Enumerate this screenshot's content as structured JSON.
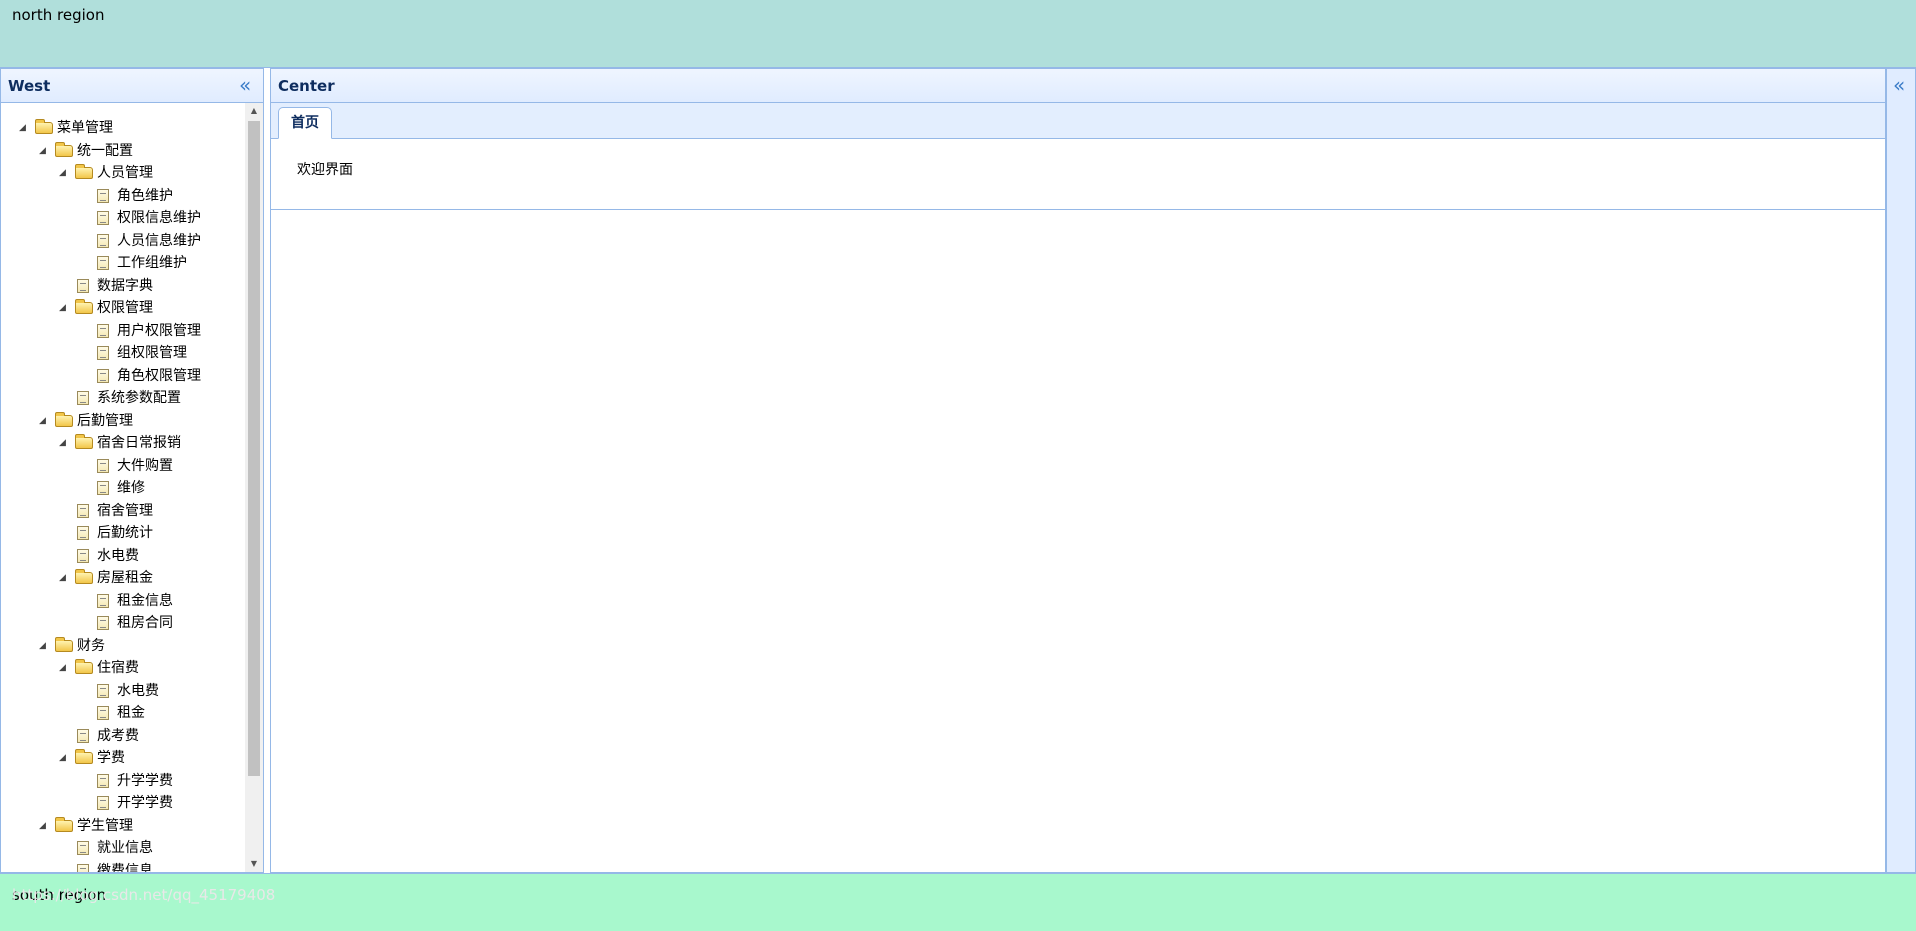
{
  "north": {
    "text": "north region"
  },
  "south": {
    "text": "south region"
  },
  "watermark": "https://blog.csdn.net/qq_45179408",
  "west": {
    "title": "West",
    "collapse_icon": "«",
    "tree": [
      {
        "label": "菜单管理",
        "type": "folder",
        "level": 0
      },
      {
        "label": "统一配置",
        "type": "folder",
        "level": 1
      },
      {
        "label": "人员管理",
        "type": "folder",
        "level": 2
      },
      {
        "label": "角色维护",
        "type": "file",
        "level": 3
      },
      {
        "label": "权限信息维护",
        "type": "file",
        "level": 3
      },
      {
        "label": "人员信息维护",
        "type": "file",
        "level": 3
      },
      {
        "label": "工作组维护",
        "type": "file",
        "level": 3
      },
      {
        "label": "数据字典",
        "type": "file",
        "level": 2
      },
      {
        "label": "权限管理",
        "type": "folder",
        "level": 2
      },
      {
        "label": "用户权限管理",
        "type": "file",
        "level": 3
      },
      {
        "label": "组权限管理",
        "type": "file",
        "level": 3
      },
      {
        "label": "角色权限管理",
        "type": "file",
        "level": 3
      },
      {
        "label": "系统参数配置",
        "type": "file",
        "level": 2
      },
      {
        "label": "后勤管理",
        "type": "folder",
        "level": 1
      },
      {
        "label": "宿舍日常报销",
        "type": "folder",
        "level": 2
      },
      {
        "label": "大件购置",
        "type": "file",
        "level": 3
      },
      {
        "label": "维修",
        "type": "file",
        "level": 3
      },
      {
        "label": "宿舍管理",
        "type": "file",
        "level": 2
      },
      {
        "label": "后勤统计",
        "type": "file",
        "level": 2
      },
      {
        "label": "水电费",
        "type": "file",
        "level": 2
      },
      {
        "label": "房屋租金",
        "type": "folder",
        "level": 2
      },
      {
        "label": "租金信息",
        "type": "file",
        "level": 3
      },
      {
        "label": "租房合同",
        "type": "file",
        "level": 3
      },
      {
        "label": "财务",
        "type": "folder",
        "level": 1
      },
      {
        "label": "住宿费",
        "type": "folder",
        "level": 2
      },
      {
        "label": "水电费",
        "type": "file",
        "level": 3
      },
      {
        "label": "租金",
        "type": "file",
        "level": 3
      },
      {
        "label": "成考费",
        "type": "file",
        "level": 2
      },
      {
        "label": "学费",
        "type": "folder",
        "level": 2
      },
      {
        "label": "升学学费",
        "type": "file",
        "level": 3
      },
      {
        "label": "开学学费",
        "type": "file",
        "level": 3
      },
      {
        "label": "学生管理",
        "type": "folder",
        "level": 1
      },
      {
        "label": "就业信息",
        "type": "file",
        "level": 2
      },
      {
        "label": "缴费信息",
        "type": "file",
        "level": 2
      }
    ]
  },
  "center": {
    "title": "Center",
    "tabs": [
      {
        "label": "首页",
        "content": "欢迎界面"
      }
    ]
  },
  "east": {
    "collapse_icon": "«"
  },
  "icons": {
    "expanded": "expanded-triangle-icon",
    "folder": "folder-open-icon",
    "file": "file-icon"
  }
}
